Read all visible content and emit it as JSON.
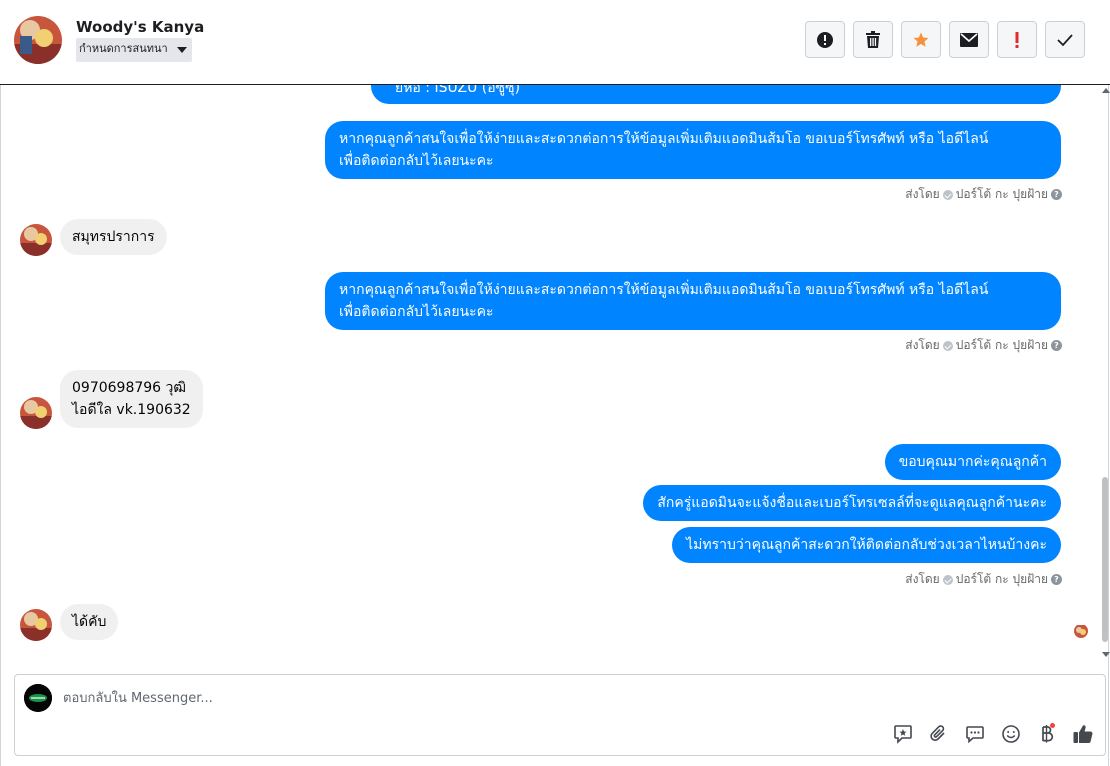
{
  "header": {
    "name": "Woody's Kanya",
    "assign_label": "กำหนดการสนทนา",
    "toolbar": {
      "spam_icon": "alert-circle-icon",
      "delete_icon": "trash-icon",
      "star_icon": "star-icon",
      "mail_icon": "envelope-icon",
      "important_icon": "exclamation-icon",
      "done_icon": "checkmark-icon"
    },
    "star_color": "#f7923b",
    "important_color": "#e02e2e"
  },
  "messages": {
    "top_partial": "ยี่ห้อ : ISUZU (อีซูซุ)",
    "m1_line1": "หากคุณลูกค้าสนใจเพื่อให้ง่ายและสะดวกต่อการให้ข้อมูลเพิ่มเติมแอดมินส้มโอ ขอเบอร์โทรศัพท์ หรือ ไอดีไลน์",
    "m1_line2": "เพื่อติดต่อกลับไว้เลยนะคะ",
    "sent1": "ส่งโดย",
    "sender1": "ปอร์โต้ กะ ปุยฝ้าย",
    "in1": "สมุทรปราการ",
    "m2_line1": "หากคุณลูกค้าสนใจเพื่อให้ง่ายและสะดวกต่อการให้ข้อมูลเพิ่มเติมแอดมินส้มโอ ขอเบอร์โทรศัพท์ หรือ ไอดีไลน์",
    "m2_line2": "เพื่อติดต่อกลับไว้เลยนะคะ",
    "sent2": "ส่งโดย",
    "sender2": "ปอร์โต้ กะ ปุยฝ้าย",
    "in2_line1": "0970698796 วุฒิ",
    "in2_line2": "ไอดีใล vk.190632",
    "m3": "ขอบคุณมากค่ะคุณลูกค้า",
    "m4": "สักครู่แอดมินจะแจ้งชื่อและเบอร์โทรเซลล์ที่จะดูแลคุณลูกค้านะคะ",
    "m5": "ไม่ทราบว่าคุณลูกค้าสะดวกให้ติดต่อกลับช่วงเวลาไหนบ้างคะ",
    "sent3": "ส่งโดย",
    "sender3": "ปอร์โต้ กะ ปุยฝ้าย",
    "in3": "ได้คับ",
    "bubble_color": "#0084ff"
  },
  "composer": {
    "placeholder": "ตอบกลับใน Messenger...",
    "icons": [
      "sticker-icon",
      "attachment-icon",
      "saved-replies-icon",
      "emoji-icon",
      "payment-icon",
      "thumbs-up-icon"
    ]
  }
}
